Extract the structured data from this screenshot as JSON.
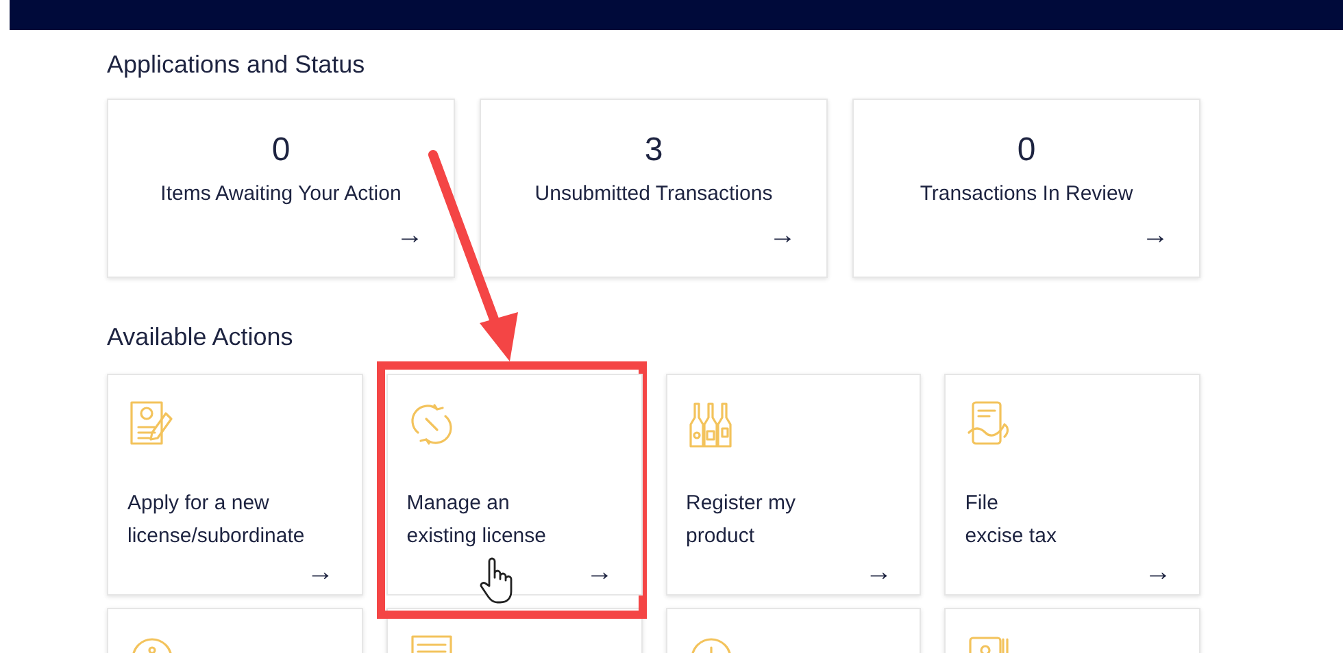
{
  "applications_and_status": {
    "heading": "Applications and Status",
    "cards": [
      {
        "count": "0",
        "label": "Items Awaiting Your Action",
        "arrow": "→"
      },
      {
        "count": "3",
        "label": "Unsubmitted Transactions",
        "arrow": "→"
      },
      {
        "count": "0",
        "label": "Transactions In Review",
        "arrow": "→"
      }
    ]
  },
  "available_actions": {
    "heading": "Available Actions",
    "cards": [
      {
        "kind": "action",
        "lines": [
          "Apply for a new",
          "license/subordinate"
        ],
        "arrow": "→",
        "selected": false
      },
      {
        "kind": "action",
        "lines": [
          "Manage an",
          "existing license"
        ],
        "arrow": "→",
        "selected": true
      },
      {
        "kind": "action",
        "lines": [
          "Register my",
          "product"
        ],
        "arrow": "→",
        "selected": false
      },
      {
        "kind": "action",
        "lines": [
          "File",
          "excise tax"
        ],
        "arrow": "→",
        "selected": false
      },
      {
        "kind": "partial"
      },
      {
        "kind": "partial"
      },
      {
        "kind": "partial"
      },
      {
        "kind": "partial"
      }
    ]
  }
}
